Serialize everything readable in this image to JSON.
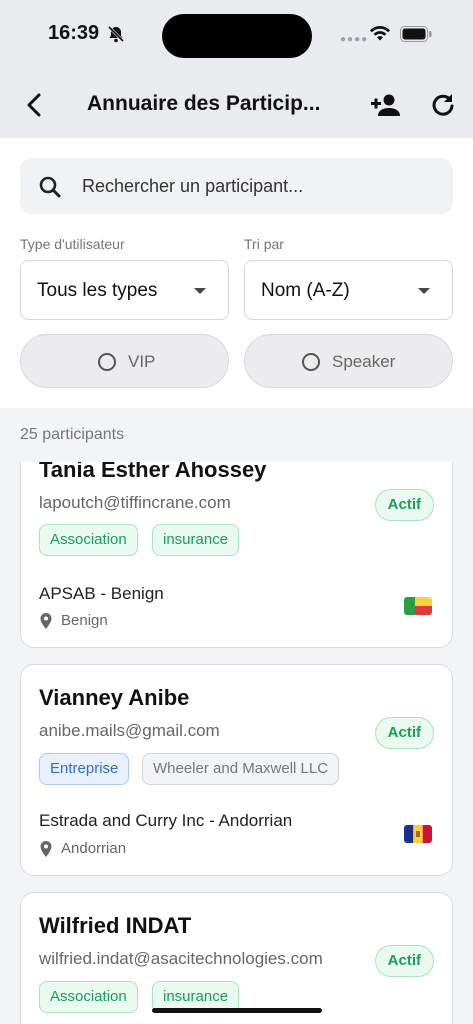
{
  "status_bar": {
    "time": "16:39"
  },
  "app_bar": {
    "title": "Annuaire des Particip..."
  },
  "search": {
    "placeholder": "Rechercher un participant..."
  },
  "filters": {
    "user_type_label": "Type d'utilisateur",
    "user_type_value": "Tous les types",
    "sort_label": "Tri par",
    "sort_value": "Nom (A-Z)",
    "vip_label": "VIP",
    "speaker_label": "Speaker"
  },
  "count_text": "25 participants",
  "participants": [
    {
      "name": "Tania Esther Ahossey",
      "email": "lapoutch@tiffincrane.com",
      "status": "Actif",
      "tags": [
        {
          "label": "Association",
          "style": "green"
        },
        {
          "label": "insurance",
          "style": "green"
        }
      ],
      "organization": "APSAB - Benign",
      "location": "Benign",
      "flag_colors": [
        "#2a9d4b",
        "#f5d33b",
        "#e03a3e"
      ]
    },
    {
      "name": "Vianney Anibe",
      "email": "anibe.mails@gmail.com",
      "status": "Actif",
      "tags": [
        {
          "label": "Entreprise",
          "style": "blue"
        },
        {
          "label": "Wheeler and Maxwell LLC",
          "style": "grey"
        }
      ],
      "organization": "Estrada and Curry Inc - Andorrian",
      "location": "Andorrian",
      "flag_colors": [
        "#1a2f8f",
        "#f5d33b",
        "#d21034"
      ]
    },
    {
      "name": "Wilfried INDAT",
      "email": "wilfried.indat@asacitechnologies.com",
      "status": "Actif",
      "tags": [
        {
          "label": "Association",
          "style": "green"
        },
        {
          "label": "insurance",
          "style": "green"
        }
      ]
    }
  ]
}
